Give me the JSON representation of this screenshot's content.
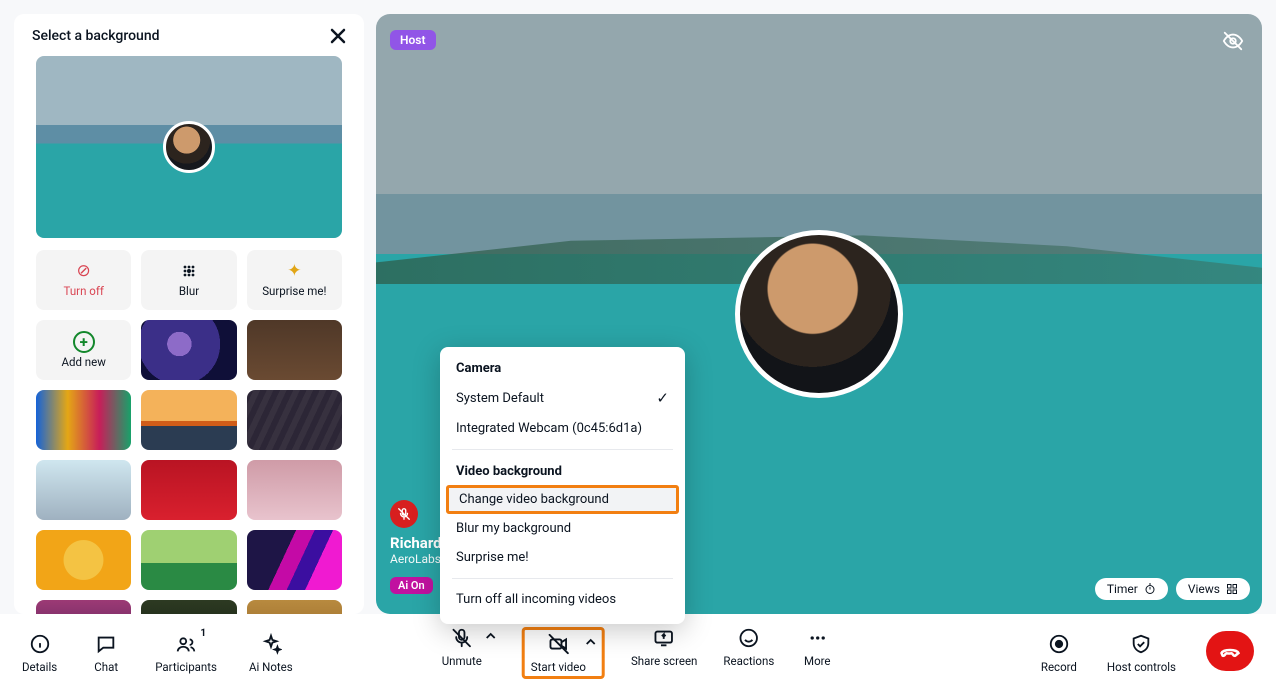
{
  "panel": {
    "title": "Select a background",
    "options": {
      "turn_off": "Turn off",
      "blur": "Blur",
      "surprise": "Surprise me!",
      "add_new": "Add new"
    },
    "thumbs": [
      {
        "bg": "radial-gradient(circle at 40% 40%, #8d6bc8 0 18%, #3b2f88 18% 60%, #0f0f38 60% 100%)"
      },
      {
        "bg": "linear-gradient(#4f3828,#6a4a32)"
      },
      {
        "bg": "linear-gradient(90deg,#1563d8,#e4a715,#c81e59,#17a26a)"
      },
      {
        "bg": "linear-gradient(#f4b25a 0 52%, #d15d19 52% 60%, #2b3c52 60% 100%)"
      },
      {
        "bg": "repeating-linear-gradient(115deg,#2c2636 0 6px,#37313f 6px 12px)"
      },
      {
        "bg": "linear-gradient(#cfe6ef,#9fb1c0)"
      },
      {
        "bg": "linear-gradient(#b91423,#d9202e)"
      },
      {
        "bg": "linear-gradient(#cf9ba7,#e8c3cd)"
      },
      {
        "bg": "radial-gradient(circle,#f4c343 0 35%,#f2a517 36% 100%)"
      },
      {
        "bg": "linear-gradient(#9fd072 0 55%,#2a8a44 55% 100%)"
      },
      {
        "bg": "linear-gradient(115deg,#1e1546 40%,#c40aa6 40% 55%,#3b0ea0 55% 70%,#f01ad1 70%)"
      },
      {
        "bg": "linear-gradient(#9c3a75,#4c1d56)"
      },
      {
        "bg": "linear-gradient(#2d3a22,#0f1a10)"
      },
      {
        "bg": "linear-gradient(#b88a3f,#8c5e22)"
      }
    ]
  },
  "video": {
    "host_badge": "Host",
    "ai_badge": "Ai On",
    "participant_name": "Richard",
    "participant_org": "AeroLabs",
    "timer_label": "Timer",
    "views_label": "Views"
  },
  "popup": {
    "camera_heading": "Camera",
    "system_default": "System Default",
    "integrated_webcam": "Integrated Webcam (0c45:6d1a)",
    "bg_heading": "Video background",
    "change_bg": "Change video background",
    "blur_bg": "Blur my background",
    "surprise": "Surprise me!",
    "turn_off_incoming": "Turn off all incoming videos"
  },
  "bar": {
    "details": "Details",
    "chat": "Chat",
    "participants": "Participants",
    "participants_count": "1",
    "ai_notes": "Ai Notes",
    "unmute": "Unmute",
    "start_video": "Start video",
    "share_screen": "Share screen",
    "reactions": "Reactions",
    "more": "More",
    "record": "Record",
    "host_controls": "Host controls"
  }
}
